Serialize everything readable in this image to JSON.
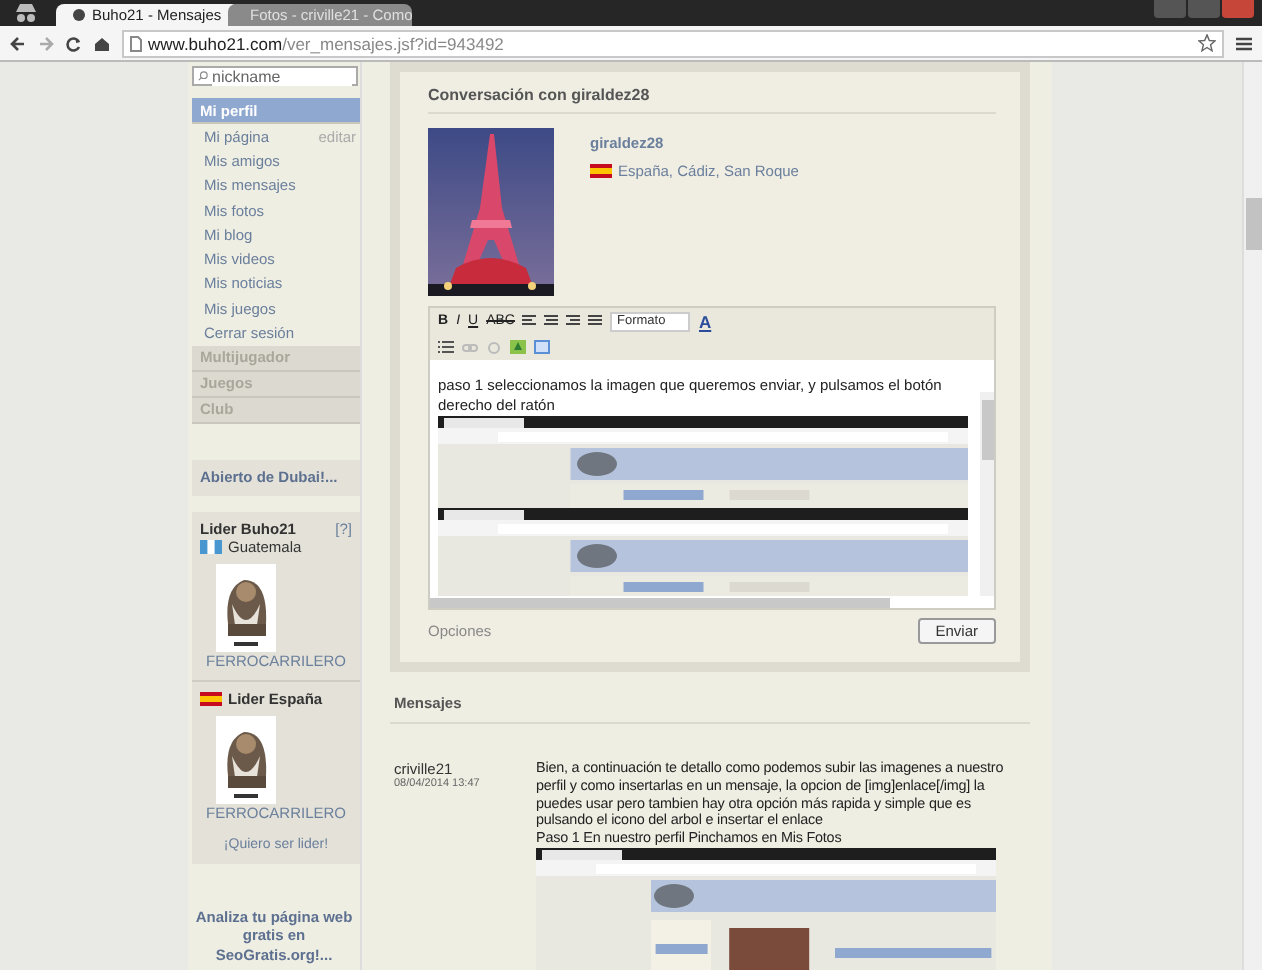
{
  "browser": {
    "tabs": [
      {
        "title": "Buho21 - Mensajes",
        "selected": true
      },
      {
        "title": "Fotos - criville21 - Como",
        "selected": false
      }
    ],
    "url_host": "www.buho21.com",
    "url_path": "/ver_mensajes.jsf?id=943492"
  },
  "sidebar": {
    "search": {
      "placeholder": "nickname"
    },
    "sections": [
      {
        "title": "Mi perfil",
        "expanded": true,
        "items": [
          {
            "label": "Mi página",
            "action": "editar"
          },
          {
            "label": "Mis amigos"
          },
          {
            "label": "Mis mensajes"
          },
          {
            "label": "Mis fotos"
          },
          {
            "label": "Mi blog"
          },
          {
            "label": "Mis videos"
          },
          {
            "label": "Mis noticias"
          },
          {
            "label": "Mis juegos"
          },
          {
            "label": "Cerrar sesión"
          }
        ]
      },
      {
        "title": "Multijugador",
        "expanded": false
      },
      {
        "title": "Juegos",
        "expanded": false
      },
      {
        "title": "Club",
        "expanded": false
      }
    ],
    "promo": "Abierto de Dubai!...",
    "leaders": {
      "title": "Lider Buho21",
      "help": "[?]",
      "country": "Guatemala",
      "country_flag": {
        "kind": "guatemala"
      },
      "name": "FERROCARRILERO",
      "second_title": "Lider España",
      "second_flag": {
        "kind": "spain"
      },
      "second_name": "FERROCARRILERO",
      "link": "¡Quiero ser lider!"
    },
    "ad": "Analiza tu página web gratis en SeoGratis.org!..."
  },
  "conversation": {
    "title": "Conversación con giraldez28",
    "user": "giraldez28",
    "location": "España, Cádiz, San Roque",
    "flag": {
      "kind": "spain"
    },
    "editor": {
      "format_buttons": [
        "B",
        "I",
        "U",
        "ABC"
      ],
      "format_select": "Formato",
      "color_button": "A",
      "text": "paso 1 seleccionamos la imagen que queremos enviar, y pulsamos el botón derecho del ratón"
    },
    "options_link": "Opciones",
    "send_button": "Enviar"
  },
  "messages": {
    "title": "Mensajes",
    "items": [
      {
        "author": "criville21",
        "date": "08/04/2014 13:47",
        "paragraphs": [
          "Bien, a continuación te detallo como podemos subir las imagenes a nuestro perfil y como insertarlas en un mensaje, la opcion de [img]enlace[/img] la puedes usar pero tambien hay otra opción más rapida y simple que es pulsando el icono del arbol e insertar el enlace",
          "Paso 1 En nuestro perfil Pinchamos en Mis Fotos"
        ]
      }
    ]
  }
}
